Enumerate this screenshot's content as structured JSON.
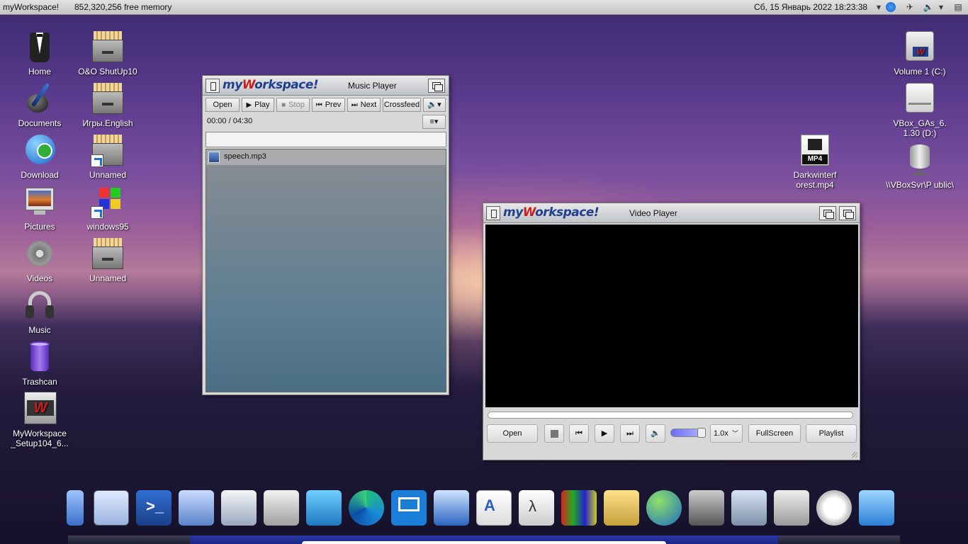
{
  "topbar": {
    "app_name": "myWorkspace!",
    "memory": "852,320,256 free memory",
    "clock": "Сб, 15 Январь 2022 18:23:38"
  },
  "desktop_icons_left": [
    {
      "label": "Home",
      "icon": "tuxedo-icon"
    },
    {
      "label": "Documents",
      "icon": "pen-inkwell-icon"
    },
    {
      "label": "Download",
      "icon": "globe-download-icon"
    },
    {
      "label": "Pictures",
      "icon": "monitor-picture-icon"
    },
    {
      "label": "Videos",
      "icon": "film-reel-icon"
    },
    {
      "label": "Music",
      "icon": "headphones-icon"
    },
    {
      "label": "Trashcan",
      "icon": "trashcan-icon"
    },
    {
      "label": "MyWorkspace _Setup104_6...",
      "icon": "installer-icon"
    }
  ],
  "desktop_icons_col2": [
    {
      "label": "O&O ShutUp10",
      "icon": "file-cabinet-icon"
    },
    {
      "label": "Игры.English",
      "icon": "file-cabinet-icon"
    },
    {
      "label": "Unnamed",
      "icon": "file-cabinet-shortcut-icon"
    },
    {
      "label": "windows95",
      "icon": "windows-flag-shortcut-icon"
    },
    {
      "label": "Unnamed",
      "icon": "file-cabinet-icon"
    }
  ],
  "desktop_icons_right": [
    {
      "label": "Volume 1 (C:)",
      "icon": "hard-drive-icon"
    },
    {
      "label": "VBox_GAs_6. 1.30 (D:)",
      "icon": "optical-drive-icon"
    },
    {
      "label": "\\\\VBoxSvr\\P ublic\\",
      "icon": "network-drive-icon"
    }
  ],
  "desktop_file": {
    "label": "Darkwinterf orest.mp4",
    "badge": "MP4"
  },
  "music_player": {
    "logo_a": "my",
    "logo_b": "W",
    "logo_c": "orkspace!",
    "title": "Music Player",
    "buttons": {
      "open": "Open",
      "play": "Play",
      "stop": "Stop",
      "prev": "Prev",
      "next": "Next",
      "crossfeed": "Crossfeed"
    },
    "time": "00:00 / 04:30",
    "playlist": [
      "speech.mp3"
    ]
  },
  "video_player": {
    "logo_a": "my",
    "logo_b": "W",
    "logo_c": "orkspace!",
    "title": "Video Player",
    "buttons": {
      "open": "Open",
      "speed": "1.0x",
      "fullscreen": "FullScreen",
      "playlist": "Playlist"
    }
  },
  "dock_items": [
    "server-icon",
    "performance-monitor-icon",
    "powershell-icon",
    "system-info-icon",
    "task-list-icon",
    "fax-printer-icon",
    "blocks-icon",
    "edge-browser-icon",
    "remote-desktop-icon",
    "network-disconnect-icon",
    "text-document-icon",
    "lambda-icon",
    "winrar-icon",
    "drive-tools-icon",
    "internet-security-icon",
    "memory-chip-icon",
    "toolbox-icon",
    "cd-drive-icon",
    "gauge-icon",
    "search-screen-icon"
  ]
}
